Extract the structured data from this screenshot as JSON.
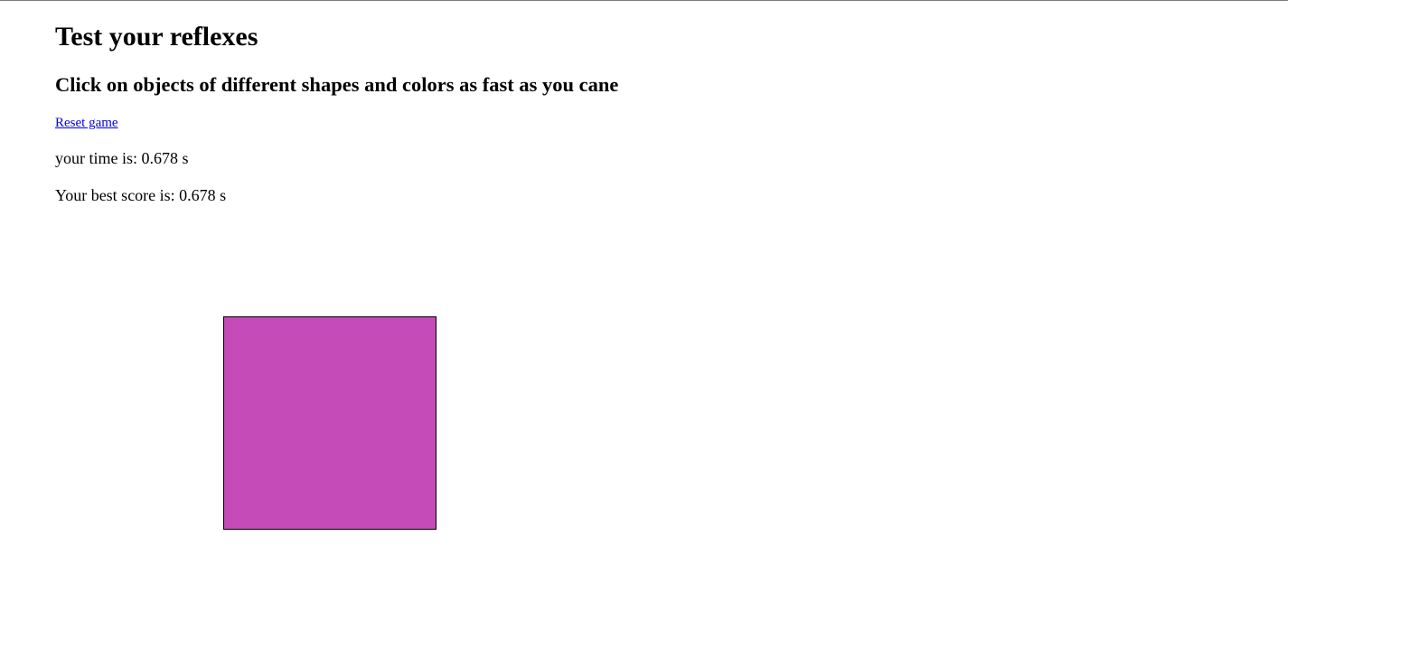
{
  "page": {
    "title": "Test your reflexes",
    "subtitle": "Click on objects of different shapes and colors as fast as you cane",
    "reset_label": "Reset game",
    "time_text": "your time is: 0.678 s",
    "best_text": "Your best score is: 0.678 s"
  },
  "target": {
    "shape": "square",
    "color": "#c54bb9",
    "border_color": "#000000"
  },
  "colors": {
    "link": "#0000ee",
    "text": "#000000",
    "background": "#ffffff"
  }
}
